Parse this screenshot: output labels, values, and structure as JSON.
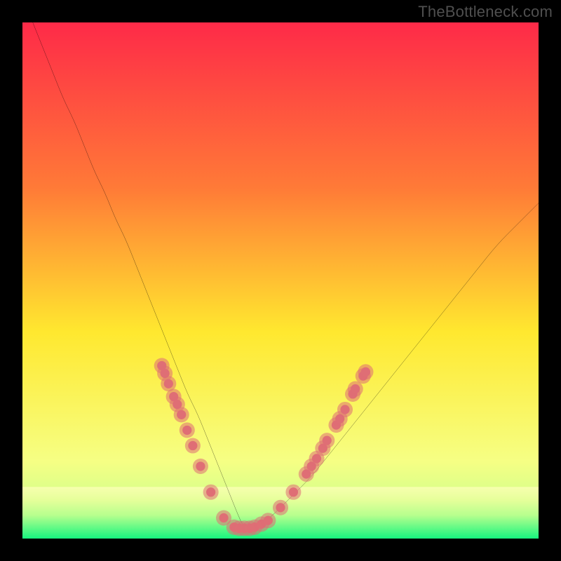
{
  "watermark": "TheBottleneck.com",
  "chart_data": {
    "type": "line",
    "title": "",
    "xlabel": "",
    "ylabel": "",
    "xlim": [
      0,
      100
    ],
    "ylim": [
      0,
      100
    ],
    "grid": false,
    "legend": false,
    "background_gradient": {
      "top": "#fe2a48",
      "upper_mid": "#ff7a37",
      "mid": "#ffe82f",
      "lower_mid": "#f6ff84",
      "band": "#d7ff8a",
      "bottom": "#17f57f"
    },
    "series": [
      {
        "name": "bottleneck-curve",
        "color": "#000000",
        "x": [
          0,
          2,
          4,
          6,
          8,
          10,
          12,
          14,
          16,
          18,
          20,
          22,
          24,
          26,
          28,
          30,
          32,
          34,
          36,
          38,
          40,
          42,
          43,
          45,
          48,
          52,
          56,
          60,
          64,
          68,
          72,
          76,
          80,
          84,
          88,
          92,
          96,
          100
        ],
        "y": [
          105,
          100,
          95,
          90,
          85,
          81,
          76,
          71,
          67,
          62,
          58,
          53,
          48,
          43,
          38,
          33,
          28,
          24,
          19,
          14,
          9,
          4,
          2,
          2,
          4,
          8,
          12,
          17,
          22,
          27,
          32,
          37,
          42,
          47,
          52,
          57,
          61,
          65
        ]
      }
    ],
    "markers": [
      {
        "name": "moving-dots",
        "color": "#df6e75",
        "radius_outer": 1.5,
        "radius_inner": 0.9,
        "points_xy": [
          [
            27.0,
            33.5
          ],
          [
            27.6,
            32.0
          ],
          [
            28.3,
            30.0
          ],
          [
            29.3,
            27.5
          ],
          [
            30.0,
            26.0
          ],
          [
            30.8,
            24.0
          ],
          [
            31.9,
            21.0
          ],
          [
            33.0,
            18.0
          ],
          [
            34.5,
            14.0
          ],
          [
            36.5,
            9.0
          ],
          [
            39.0,
            4.0
          ],
          [
            41.0,
            2.2
          ],
          [
            42.0,
            2.0
          ],
          [
            43.0,
            2.0
          ],
          [
            44.0,
            2.0
          ],
          [
            45.0,
            2.2
          ],
          [
            46.3,
            2.8
          ],
          [
            47.6,
            3.5
          ],
          [
            50.0,
            6.0
          ],
          [
            52.5,
            9.0
          ],
          [
            55.0,
            12.5
          ],
          [
            56.0,
            14.0
          ],
          [
            57.0,
            15.5
          ],
          [
            58.2,
            17.5
          ],
          [
            59.0,
            19.0
          ],
          [
            60.8,
            22.0
          ],
          [
            61.5,
            23.2
          ],
          [
            62.5,
            25.0
          ],
          [
            64.0,
            28.0
          ],
          [
            64.5,
            29.0
          ],
          [
            66.0,
            31.5
          ],
          [
            66.5,
            32.3
          ]
        ]
      }
    ],
    "highlight_band": {
      "y_top": 10,
      "color_top": "#f6ff84",
      "color_bottom": "#17f57f"
    }
  }
}
